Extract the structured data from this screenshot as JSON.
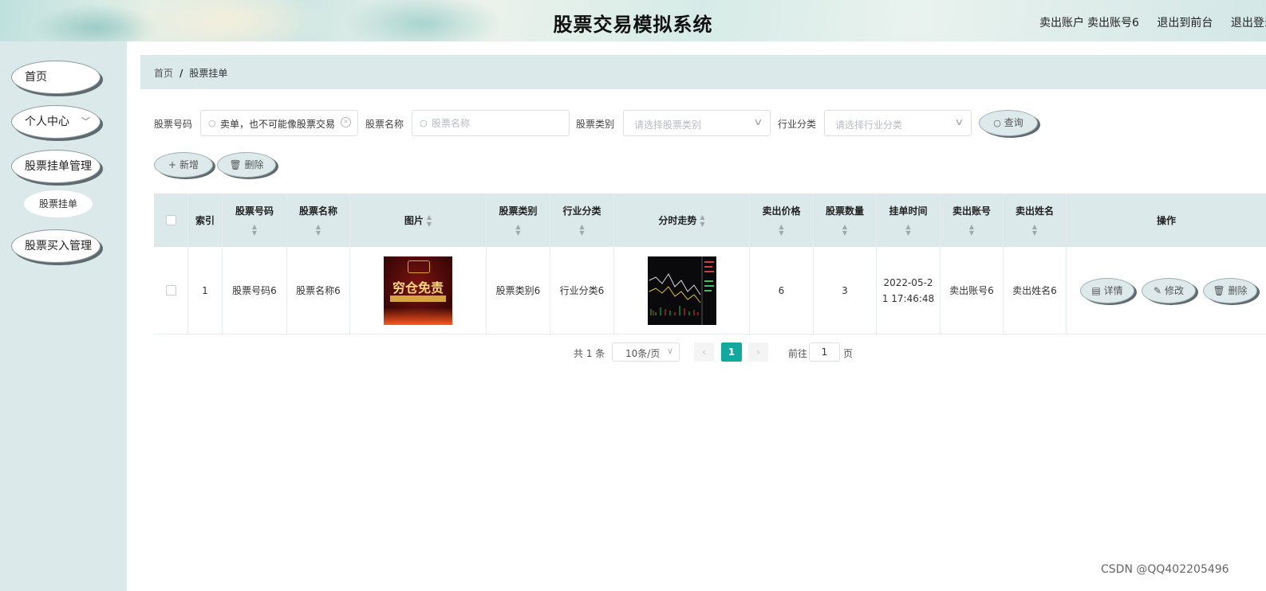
{
  "header": {
    "title": "股票交易模拟系统",
    "account_label": "卖出账户",
    "account_name": "卖出账号6",
    "back_link": "退出到前台",
    "logout_link": "退出登录"
  },
  "sidebar": {
    "items": [
      {
        "label": "首页"
      },
      {
        "label": "个人中心"
      },
      {
        "label": "股票挂单管理"
      },
      {
        "label": "股票挂单"
      },
      {
        "label": "股票买入管理"
      }
    ]
  },
  "breadcrumb": {
    "home": "首页",
    "separator": "/",
    "current": "股票挂单"
  },
  "filters": {
    "code_label": "股票号码",
    "code_value": "卖单，也不可能像股票交易",
    "name_label": "股票名称",
    "name_placeholder": "股票名称",
    "type_label": "股票类别",
    "type_placeholder": "请选择股票类别",
    "industry_label": "行业分类",
    "industry_placeholder": "请选择行业分类",
    "search_button": "查询"
  },
  "actions": {
    "add_button": "新增",
    "delete_button": "删除"
  },
  "table": {
    "headers": [
      "索引",
      "股票号码",
      "股票名称",
      "图片",
      "股票类别",
      "行业分类",
      "分时走势",
      "卖出价格",
      "股票数量",
      "挂单时间",
      "卖出账号",
      "卖出姓名",
      "操作"
    ],
    "rows": [
      {
        "index": "1",
        "code": "股票号码6",
        "name": "股票名称6",
        "image_text": "穷仓免责",
        "type": "股票类别6",
        "industry": "行业分类6",
        "price": "6",
        "quantity": "3",
        "time_line1": "2022-05-2",
        "time_line2": "1 17:46:48",
        "account": "卖出账号6",
        "seller": "卖出姓名6",
        "ops": {
          "detail": "详情",
          "edit": "修改",
          "delete": "删除"
        }
      }
    ]
  },
  "pagination": {
    "total": "共 1 条",
    "page_size": "10条/页",
    "current_page": "1",
    "goto_label": "前往",
    "goto_value": "1",
    "page_suffix": "页"
  },
  "watermark": "CSDN @QQ402205496",
  "colors": {
    "accent": "#13a89e",
    "sidebar_bg": "#dbe9ea",
    "pill_bg": "#dde9ea"
  }
}
